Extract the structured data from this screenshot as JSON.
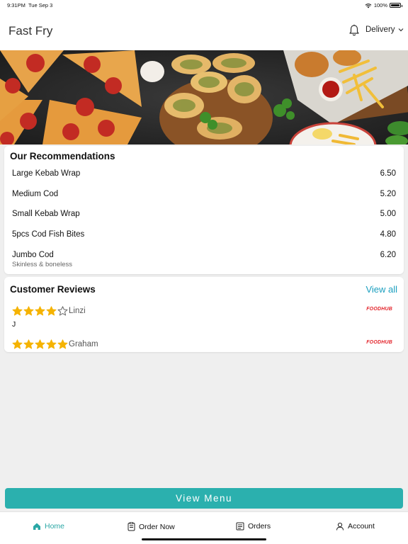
{
  "status": {
    "time": "9:31PM",
    "date": "Tue Sep 3",
    "battery": "100%"
  },
  "header": {
    "title": "Fast Fry",
    "delivery_label": "Delivery"
  },
  "recommendations": {
    "title": "Our Recommendations",
    "items": [
      {
        "name": "Large Kebab Wrap",
        "price": "6.50"
      },
      {
        "name": "Medium Cod",
        "price": "5.20"
      },
      {
        "name": "Small Kebab Wrap",
        "price": "5.00"
      },
      {
        "name": "5pcs Cod Fish Bites",
        "price": "4.80"
      },
      {
        "name": "Jumbo Cod",
        "price": "6.20",
        "subtitle": "Skinless & boneless"
      }
    ]
  },
  "reviews": {
    "title": "Customer Reviews",
    "view_all": "View all",
    "items": [
      {
        "name": "Linzi",
        "rating": 4,
        "text": "J",
        "source": "FOODHUB"
      },
      {
        "name": "Graham",
        "rating": 5,
        "text": "",
        "source": "FOODHUB"
      }
    ]
  },
  "view_menu_label": "View Menu",
  "tabs": [
    {
      "label": "Home",
      "icon": "home-icon",
      "active": true
    },
    {
      "label": "Order Now",
      "icon": "order-icon",
      "active": false
    },
    {
      "label": "Orders",
      "icon": "orders-icon",
      "active": false
    },
    {
      "label": "Account",
      "icon": "account-icon",
      "active": false
    }
  ],
  "colors": {
    "accent": "#2bb0ae",
    "link": "#1b9fbf",
    "star": "#f5b301",
    "foodhub": "#e3242b"
  }
}
